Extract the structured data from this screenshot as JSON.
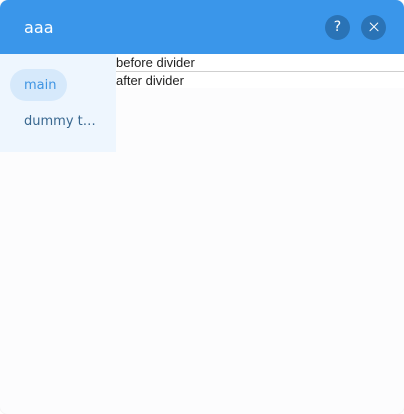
{
  "window": {
    "title": "aaa"
  },
  "header": {
    "help_symbol": "?",
    "accent_color": "#3a96ea"
  },
  "sidebar": {
    "items": [
      {
        "label": "main",
        "active": true
      },
      {
        "label": "dummy t…",
        "active": false
      }
    ]
  },
  "content": {
    "before_text": "before divider",
    "after_text": "after divider"
  },
  "icons": {
    "help": "help-icon",
    "close": "close-icon"
  }
}
